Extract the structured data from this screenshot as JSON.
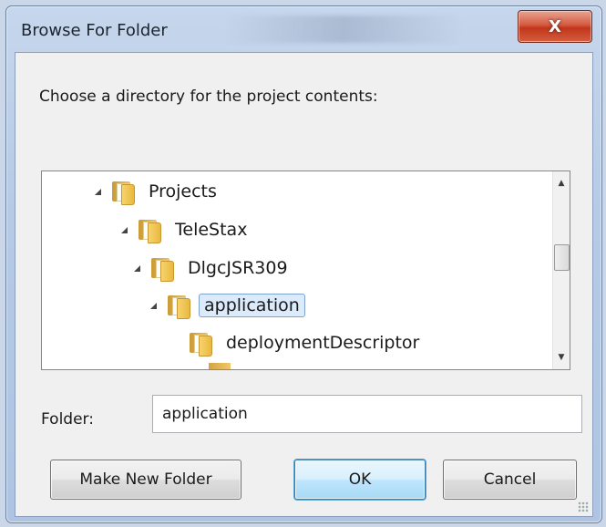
{
  "window": {
    "title": "Browse For Folder",
    "close_glyph": "X"
  },
  "prompt": "Choose a directory for the project contents:",
  "tree": {
    "items": [
      {
        "label": "Projects",
        "expanded": true
      },
      {
        "label": "TeleStax",
        "expanded": true
      },
      {
        "label": "DlgcJSR309",
        "expanded": true
      },
      {
        "label": "application",
        "expanded": true,
        "selected": true
      },
      {
        "label": "deploymentDescriptor",
        "expanded": false
      }
    ],
    "scroll_up_glyph": "▲",
    "scroll_down_glyph": "▼"
  },
  "folder_field": {
    "label": "Folder:",
    "value": "application"
  },
  "buttons": {
    "make_new_folder": "Make New Folder",
    "ok": "OK",
    "cancel": "Cancel"
  },
  "colors": {
    "selection_bg": "#dcebfc",
    "selection_border": "#7da2ce",
    "close_red": "#c2361b",
    "folder_yellow": "#f7d46e"
  }
}
